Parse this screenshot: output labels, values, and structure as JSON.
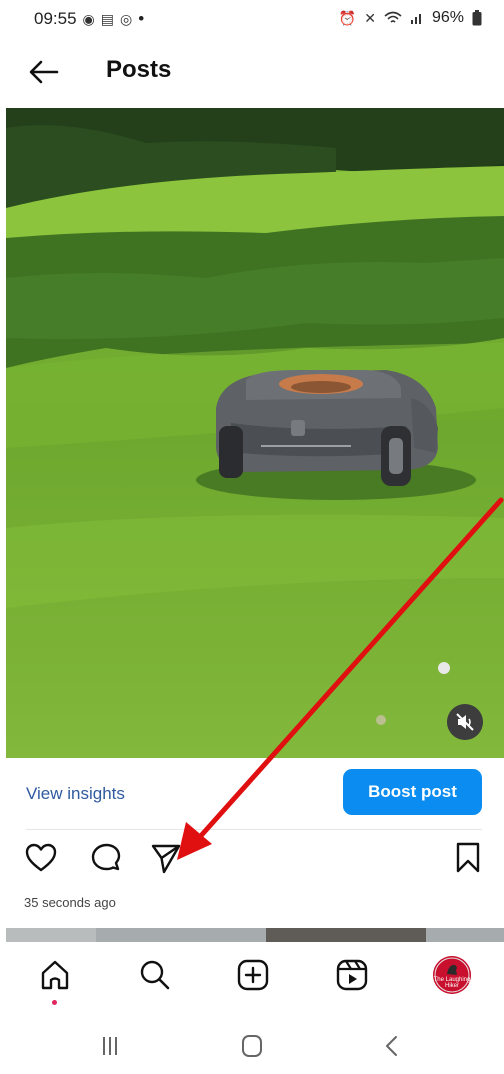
{
  "status_bar": {
    "time": "09:55",
    "dot": "•",
    "battery": "96%",
    "left_icons": [
      "location-icon",
      "news-icon",
      "instagram-icon"
    ],
    "right_icons": [
      "alarm-icon",
      "mute-icon",
      "wifi-icon",
      "signal-icon",
      "battery-icon"
    ]
  },
  "header": {
    "title": "Posts"
  },
  "post": {
    "view_insights_label": "View insights",
    "boost_label": "Boost post",
    "timestamp": "35 seconds ago"
  },
  "avatar": {
    "text": "The Laughing Hiker"
  },
  "colors": {
    "accent_blue": "#0b8cf0",
    "link_blue": "#2f5aa0",
    "avatar_red": "#c8102e",
    "arrow_red": "#e01010",
    "notification_dot": "#e0245e"
  }
}
